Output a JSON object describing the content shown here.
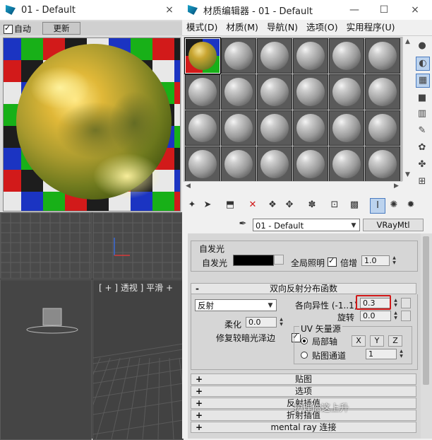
{
  "preview_window": {
    "title": "01 - Default",
    "close_glyph": "×",
    "auto_label": "自动",
    "auto_checked": true,
    "update_button": "更新"
  },
  "viewports": {
    "perspective_label": "[ + ] 透视 ] 平滑 +"
  },
  "editor_window": {
    "title": "材质编辑器 - 01 - Default",
    "minimize_glyph": "—",
    "maximize_glyph": "☐",
    "close_glyph": "×",
    "menu": [
      "模式(D)",
      "材质(M)",
      "导航(N)",
      "选项(O)",
      "实用程序(U)"
    ]
  },
  "material": {
    "name": "01 - Default",
    "type_button": "VRayMtl"
  },
  "self_illum": {
    "group_label": "自发光",
    "label": "自发光",
    "gi_label": "全局照明",
    "gi_checked": true,
    "multiplier_label": "倍增",
    "multiplier_value": "1.0"
  },
  "brdf": {
    "rollout_sign": "-",
    "rollout_title": "双向反射分布函数",
    "type_value": "反射",
    "anisotropy_label": "各向异性 (-1..1)",
    "anisotropy_value": "0.3",
    "rotation_label": "旋转",
    "rotation_value": "0.0",
    "soften_label": "柔化",
    "soften_value": "0.0",
    "fix_dark_label": "修复较暗光泽边",
    "fix_dark_checked": true,
    "uv_group_label": "UV 矢量源",
    "local_axis_label": "局部轴",
    "axis_x": "X",
    "axis_y": "Y",
    "axis_z": "Z",
    "map_channel_label": "贴图通道",
    "map_channel_value": "1"
  },
  "rollouts": [
    {
      "sign": "+",
      "title": "贴图"
    },
    {
      "sign": "+",
      "title": "选项"
    },
    {
      "sign": "+",
      "title": "反射插值"
    },
    {
      "sign": "+",
      "title": "折射插值"
    },
    {
      "sign": "+",
      "title": "mental ray 连接"
    }
  ],
  "watermark": "护理你这上升"
}
